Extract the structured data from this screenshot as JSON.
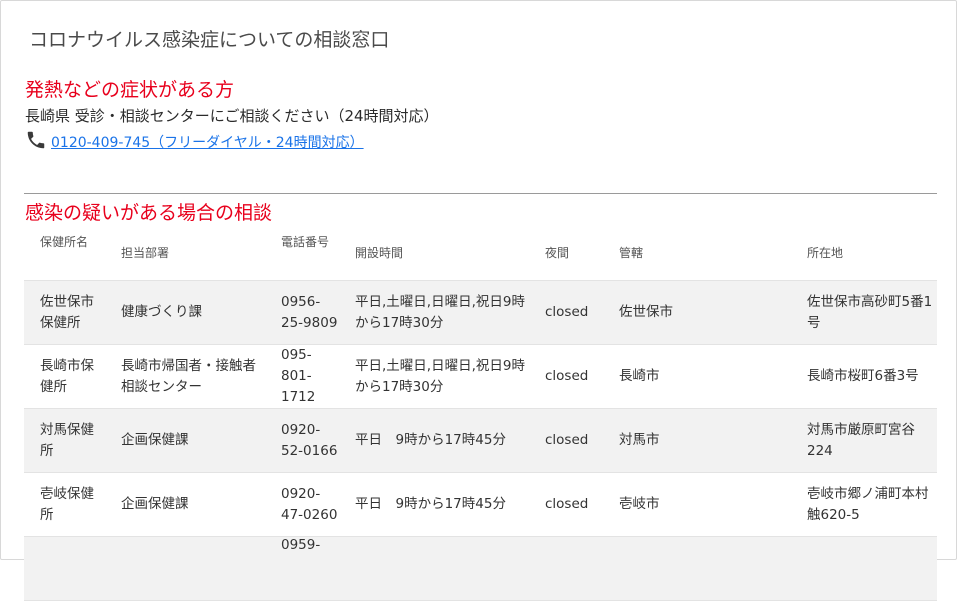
{
  "page": {
    "title": "コロナウイルス感染症についての相談窓口"
  },
  "fever": {
    "heading": "発熱などの症状がある方",
    "text": "長崎県 受診・相談センターにご相談ください（24時間対応）",
    "phone_link": "0120-409-745（フリーダイヤル・24時間対応）",
    "phone_icon": "phone-icon"
  },
  "suspect": {
    "heading": "感染の疑いがある場合の相談",
    "columns": {
      "name": "保健所名",
      "dept": "担当部署",
      "tel": "電話番号",
      "hours": "開設時間",
      "night": "夜間",
      "juris": "管轄",
      "addr": "所在地"
    },
    "rows": [
      {
        "name": "佐世保市保健所",
        "dept": "健康づくり課",
        "tel": "0956-25-9809",
        "hours": "平日,土曜日,日曜日,祝日9時から17時30分",
        "night": "closed",
        "juris": "佐世保市",
        "addr": "佐世保市高砂町5番1号"
      },
      {
        "name": "長崎市保健所",
        "dept": "長崎市帰国者・接触者相談センター",
        "tel": "095-801-1712",
        "hours": "平日,土曜日,日曜日,祝日9時から17時30分",
        "night": "closed",
        "juris": "長崎市",
        "addr": "長崎市桜町6番3号"
      },
      {
        "name": "対馬保健所",
        "dept": "企画保健課",
        "tel": "0920-52-0166",
        "hours": "平日　9時から17時45分",
        "night": "closed",
        "juris": "対馬市",
        "addr": "対馬市厳原町宮谷224"
      },
      {
        "name": "壱岐保健所",
        "dept": "企画保健課",
        "tel": "0920-47-0260",
        "hours": "平日　9時から17時45分",
        "night": "closed",
        "juris": "壱岐市",
        "addr": "壱岐市郷ノ浦町本村触620-5"
      },
      {
        "name": "",
        "dept": "",
        "tel": "0959-",
        "hours": "",
        "night": "",
        "juris": "",
        "addr": ""
      }
    ]
  }
}
